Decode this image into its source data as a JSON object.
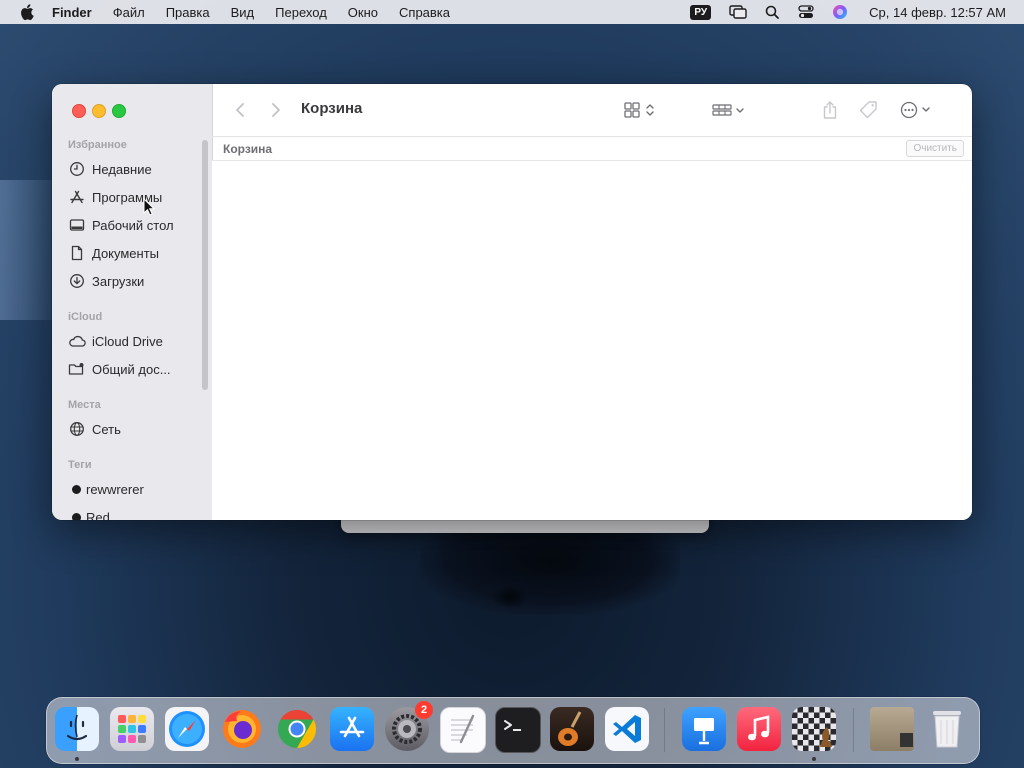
{
  "menubar": {
    "app_name": "Finder",
    "items": [
      "Файл",
      "Правка",
      "Вид",
      "Переход",
      "Окно",
      "Справка"
    ],
    "keyboard_layout": "РУ",
    "clock": "Ср, 14 февр.  12:57 AM"
  },
  "window": {
    "title": "Корзина",
    "path_label": "Корзина",
    "clear_button": "Очистить"
  },
  "sidebar": {
    "favorites_header": "Избранное",
    "favorites": [
      {
        "label": "Недавние",
        "icon": "clock-icon"
      },
      {
        "label": "Программы",
        "icon": "applications-icon"
      },
      {
        "label": "Рабочий стол",
        "icon": "desktop-icon"
      },
      {
        "label": "Документы",
        "icon": "document-icon"
      },
      {
        "label": "Загрузки",
        "icon": "downloads-icon"
      }
    ],
    "icloud_header": "iCloud",
    "icloud": [
      {
        "label": "iCloud Drive",
        "icon": "cloud-icon"
      },
      {
        "label": "Общий дос...",
        "icon": "shared-folder-icon"
      }
    ],
    "places_header": "Места",
    "places": [
      {
        "label": "Сеть",
        "icon": "globe-icon"
      }
    ],
    "tags_header": "Теги",
    "tags": [
      {
        "label": "rewwrerer",
        "color": "#1c1c1e"
      },
      {
        "label": "Red",
        "color": "#1c1c1e"
      }
    ]
  },
  "dock": {
    "apps": [
      "Finder",
      "Launchpad",
      "Safari",
      "Firefox",
      "Chrome",
      "App Store",
      "System Preferences",
      "TextEdit",
      "Terminal",
      "GarageBand",
      "Visual Studio Code",
      "Keynote",
      "Music",
      "Chess",
      "Preview",
      "Trash"
    ],
    "system_preferences_badge": "2"
  },
  "colors": {
    "accent": "#0a84ff",
    "sidebar_bg": "#e9e9ed",
    "badge_red": "#ff3b30"
  }
}
